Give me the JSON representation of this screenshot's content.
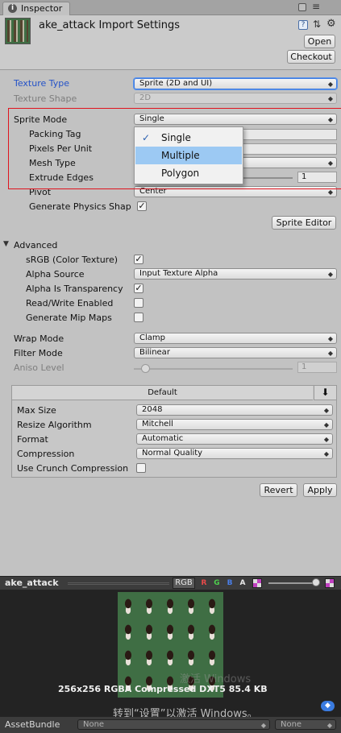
{
  "tab": {
    "label": "Inspector"
  },
  "header": {
    "title": "ake_attack Import Settings",
    "open_label": "Open",
    "checkout_label": "Checkout"
  },
  "texture_type": {
    "label": "Texture Type",
    "value": "Sprite (2D and UI)"
  },
  "texture_shape": {
    "label": "Texture Shape",
    "value": "2D"
  },
  "sprite_mode": {
    "label": "Sprite Mode",
    "value": "Single"
  },
  "packing_tag": {
    "label": "Packing Tag"
  },
  "pixels_per_unit": {
    "label": "Pixels Per Unit"
  },
  "mesh_type": {
    "label": "Mesh Type"
  },
  "extrude_edges": {
    "label": "Extrude Edges",
    "value": "1"
  },
  "pivot": {
    "label": "Pivot",
    "value": "Center"
  },
  "generate_physics_shape": {
    "label": "Generate Physics Shap",
    "checked": true
  },
  "sprite_editor": {
    "label": "Sprite Editor"
  },
  "popup": {
    "options": [
      "Single",
      "Multiple",
      "Polygon"
    ],
    "selected": "Single",
    "highlighted": "Multiple"
  },
  "advanced": {
    "label": "Advanced",
    "srgb": {
      "label": "sRGB (Color Texture)",
      "checked": true
    },
    "alpha_source": {
      "label": "Alpha Source",
      "value": "Input Texture Alpha"
    },
    "alpha_is_transparency": {
      "label": "Alpha Is Transparency",
      "checked": true
    },
    "read_write": {
      "label": "Read/Write Enabled",
      "checked": false
    },
    "mipmaps": {
      "label": "Generate Mip Maps",
      "checked": false
    }
  },
  "wrap_mode": {
    "label": "Wrap Mode",
    "value": "Clamp"
  },
  "filter_mode": {
    "label": "Filter Mode",
    "value": "Bilinear"
  },
  "aniso_level": {
    "label": "Aniso Level",
    "value": "1"
  },
  "platform": {
    "tab_label": "Default",
    "max_size": {
      "label": "Max Size",
      "value": "2048"
    },
    "resize": {
      "label": "Resize Algorithm",
      "value": "Mitchell"
    },
    "format": {
      "label": "Format",
      "value": "Automatic"
    },
    "compression": {
      "label": "Compression",
      "value": "Normal Quality"
    },
    "crunch": {
      "label": "Use Crunch Compression",
      "checked": false
    }
  },
  "actions": {
    "revert_label": "Revert",
    "apply_label": "Apply"
  },
  "preview": {
    "name": "ake_attack",
    "rgb_label": "RGB",
    "channels": [
      "R",
      "G",
      "B",
      "A"
    ],
    "info": "256x256  RGBA Compressed DXT5   85.4 KB",
    "watermark_top": "激活 Windows",
    "watermark": "转到“设置”以激活 Windows。",
    "asset_bundle_label": "AssetBundle",
    "bundle_value": "None",
    "variant_value": "None"
  },
  "colors": {
    "highlight": "#9cc9f3",
    "annotation_box": "#e0141e",
    "preview_bg": "#3f6e44"
  }
}
